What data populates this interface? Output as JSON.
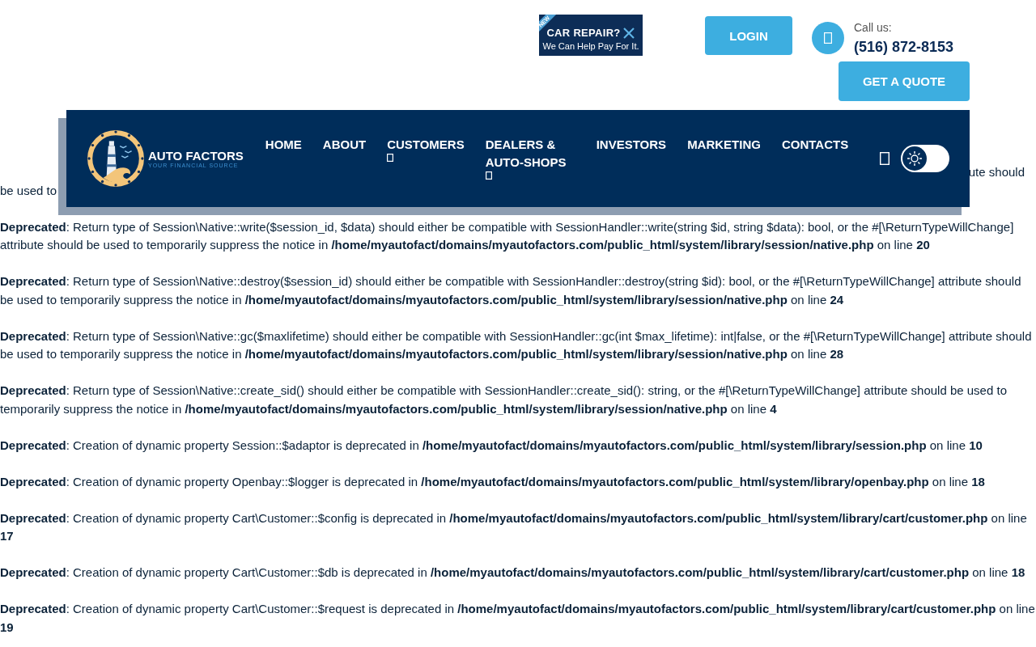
{
  "promo": {
    "badge": "NEW",
    "title": "CAR REPAIR?",
    "subtitle": "We Can Help Pay For It."
  },
  "login": "LOGIN",
  "call": {
    "label": "Call us:",
    "phone": "(516) 872-8153"
  },
  "quote": "GET A QUOTE",
  "nav": {
    "logo": {
      "name": "AUTO FACTORS",
      "tagline": "YOUR FINANCIAL SOURCE"
    },
    "items": [
      {
        "label": "HOME",
        "dropdown": false
      },
      {
        "label": "ABOUT",
        "dropdown": false
      },
      {
        "label": "CUSTOMERS",
        "dropdown": true
      },
      {
        "label": "DEALERS & AUTO-SHOPS",
        "dropdown": true
      },
      {
        "label": "INVESTORS",
        "dropdown": false
      },
      {
        "label": "MARKETING",
        "dropdown": false
      },
      {
        "label": "CONTACTS",
        "dropdown": false
      }
    ],
    "theme_toggle": {
      "on": false
    }
  },
  "hidden_notice": {
    "right_fragment": "ute should",
    "left_fragment": "be used to"
  },
  "notices": [
    "**Deprecated**: Return type of Session\\Native::write($session_id, $data) should either be compatible with SessionHandler::write(string $id, string $data): bool, or the #[\\ReturnTypeWillChange] attribute should be used to temporarily suppress the notice in **/home/myautofact/domains/myautofactors.com/public_html/system/library/session/native.php** on line **20**",
    "**Deprecated**: Return type of Session\\Native::destroy($session_id) should either be compatible with SessionHandler::destroy(string $id): bool, or the #[\\ReturnTypeWillChange] attribute should be used to temporarily suppress the notice in **/home/myautofact/domains/myautofactors.com/public_html/system/library/session/native.php** on line **24**",
    "**Deprecated**: Return type of Session\\Native::gc($maxlifetime) should either be compatible with SessionHandler::gc(int $max_lifetime): int|false, or the #[\\ReturnTypeWillChange] attribute should be used to temporarily suppress the notice in **/home/myautofact/domains/myautofactors.com/public_html/system/library/session/native.php** on line **28**",
    "**Deprecated**: Return type of Session\\Native::create_sid() should either be compatible with SessionHandler::create_sid(): string, or the #[\\ReturnTypeWillChange] attribute should be used to temporarily suppress the notice in **/home/myautofact/domains/myautofactors.com/public_html/system/library/session/native.php** on line **4**",
    "**Deprecated**: Creation of dynamic property Session::$adaptor is deprecated in **/home/myautofact/domains/myautofactors.com/public_html/system/library/session.php** on line **10**",
    "**Deprecated**: Creation of dynamic property Openbay::$logger is deprecated in **/home/myautofact/domains/myautofactors.com/public_html/system/library/openbay.php** on line **18**",
    "**Deprecated**: Creation of dynamic property Cart\\Customer::$config is deprecated in **/home/myautofact/domains/myautofactors.com/public_html/system/library/cart/customer.php** on line **17**",
    "**Deprecated**: Creation of dynamic property Cart\\Customer::$db is deprecated in **/home/myautofact/domains/myautofactors.com/public_html/system/library/cart/customer.php** on line **18**",
    "**Deprecated**: Creation of dynamic property Cart\\Customer::$request is deprecated in **/home/myautofact/domains/myautofactors.com/public_html/system/library/cart/customer.php** on line **19**"
  ]
}
